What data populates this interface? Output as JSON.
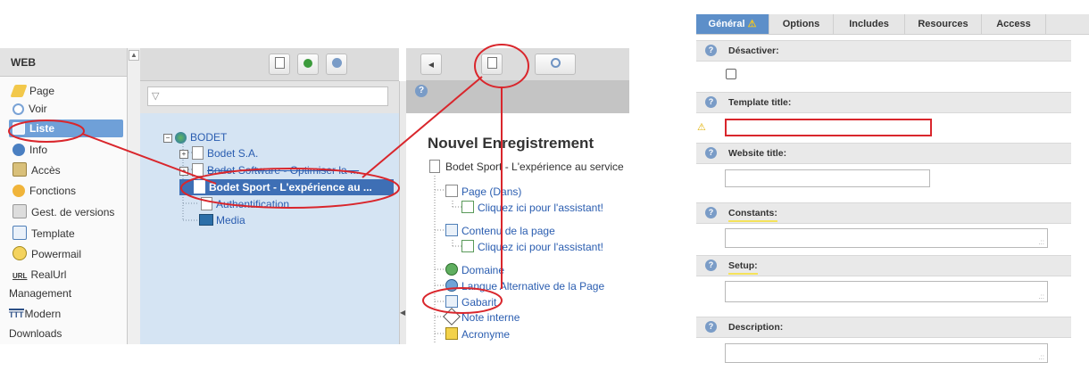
{
  "module_menu": {
    "header": "WEB",
    "items": [
      {
        "label": "Page",
        "icon": "pencil-icon"
      },
      {
        "label": "Voir",
        "icon": "magnifier-icon"
      },
      {
        "label": "Liste",
        "icon": "list-icon"
      },
      {
        "label": "Info",
        "icon": "info-icon"
      },
      {
        "label": "Accès",
        "icon": "lock-icon"
      },
      {
        "label": "Fonctions",
        "icon": "gear-icon"
      },
      {
        "label": "Gest. de versions",
        "icon": "versions-icon"
      },
      {
        "label": "Template",
        "icon": "template-icon"
      },
      {
        "label": "Powermail",
        "icon": "powermail-icon"
      },
      {
        "label": "RealUrl",
        "icon": "url-icon",
        "icon_text": "URL"
      },
      {
        "label": "Management"
      },
      {
        "label": "Modern",
        "icon": "modern-icon",
        "icon_text": "TTT"
      },
      {
        "label": "Downloads"
      }
    ],
    "selected": "Liste"
  },
  "page_tree": {
    "root": "BODET",
    "nodes": [
      {
        "label": "Bodet S.A."
      },
      {
        "label": "Bodet Software - Optimiser la ..."
      },
      {
        "label": "Bodet Sport - L'expérience au ..."
      },
      {
        "label": "Authentification"
      },
      {
        "label": "Media"
      }
    ]
  },
  "new_record": {
    "title": "Nouvel Enregistrement",
    "page_path": "Bodet Sport - L'expérience au service",
    "items": [
      {
        "label": "Page (Dans)"
      },
      {
        "label": "Cliquez ici pour l'assistant!"
      },
      {
        "label": "Contenu de la page"
      },
      {
        "label": "Cliquez ici pour l'assistant!"
      },
      {
        "label": "Domaine"
      },
      {
        "label": "Langue Alternative de la Page"
      },
      {
        "label": "Gabarit"
      },
      {
        "label": "Note interne"
      },
      {
        "label": "Acronyme"
      }
    ]
  },
  "form": {
    "tabs": [
      {
        "label": "Général",
        "warning": "⚠"
      },
      {
        "label": "Options"
      },
      {
        "label": "Includes"
      },
      {
        "label": "Resources"
      },
      {
        "label": "Access"
      }
    ],
    "sections": [
      {
        "label": "Désactiver:"
      },
      {
        "label": "Template title:",
        "warning": "⚠"
      },
      {
        "label": "Website title:"
      },
      {
        "label": "Constants:"
      },
      {
        "label": "Setup:"
      },
      {
        "label": "Description:"
      }
    ]
  },
  "colors": {
    "annotation": "#d9262c",
    "selection": "#6fa0d8",
    "tree_bg": "#d5e4f3",
    "link": "#2a5db0"
  }
}
